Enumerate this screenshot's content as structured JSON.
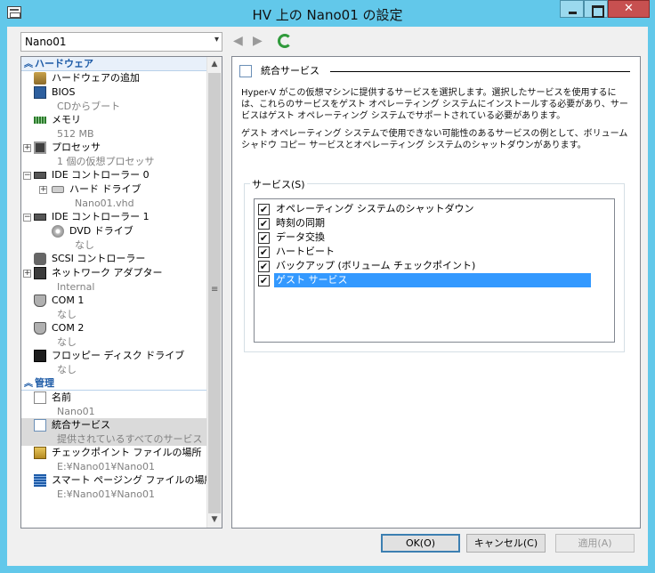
{
  "window": {
    "title": "HV 上の Nano01 の設定"
  },
  "vm_selector": {
    "value": "Nano01"
  },
  "tree": {
    "hardware_header": "ハードウェア",
    "management_header": "管理",
    "items": [
      {
        "label": "ハードウェアの追加",
        "sub": ""
      },
      {
        "label": "BIOS",
        "sub": "CDからブート"
      },
      {
        "label": "メモリ",
        "sub": "512 MB"
      },
      {
        "label": "プロセッサ",
        "sub": "1 個の仮想プロセッサ"
      },
      {
        "label": "IDE コントローラー 0",
        "sub": ""
      },
      {
        "label": "ハード ドライブ",
        "sub": "Nano01.vhd"
      },
      {
        "label": "IDE コントローラー 1",
        "sub": ""
      },
      {
        "label": "DVD ドライブ",
        "sub": "なし"
      },
      {
        "label": "SCSI コントローラー",
        "sub": ""
      },
      {
        "label": "ネットワーク アダプター",
        "sub": "Internal"
      },
      {
        "label": "COM 1",
        "sub": "なし"
      },
      {
        "label": "COM 2",
        "sub": "なし"
      },
      {
        "label": "フロッピー ディスク ドライブ",
        "sub": "なし"
      }
    ],
    "mgmt_items": [
      {
        "label": "名前",
        "sub": "Nano01"
      },
      {
        "label": "統合サービス",
        "sub": "提供されているすべてのサービス"
      },
      {
        "label": "チェックポイント ファイルの場所",
        "sub": "E:¥Nano01¥Nano01"
      },
      {
        "label": "スマート ページング ファイルの場所",
        "sub": "E:¥Nano01¥Nano01"
      }
    ]
  },
  "panel": {
    "title": "統合サービス",
    "desc1": "Hyper-V がこの仮想マシンに提供するサービスを選択します。選択したサービスを使用するには、これらのサービスをゲスト オペレーティング システムにインストールする必要があり、サービスはゲスト オペレーティング システムでサポートされている必要があります。",
    "desc2": "ゲスト オペレーティング システムで使用できない可能性のあるサービスの例として、ボリューム シャドウ コピー サービスとオペレーティング システムのシャットダウンがあります。",
    "group_label": "サービス(S)",
    "services": [
      {
        "label": "オペレーティング システムのシャットダウン",
        "checked": true
      },
      {
        "label": "時刻の同期",
        "checked": true
      },
      {
        "label": "データ交換",
        "checked": true
      },
      {
        "label": "ハートビート",
        "checked": true
      },
      {
        "label": "バックアップ (ボリューム チェックポイント)",
        "checked": true
      },
      {
        "label": "ゲスト サービス",
        "checked": true
      }
    ],
    "check_mark": "✔"
  },
  "buttons": {
    "ok": "OK(O)",
    "cancel": "キャンセル(C)",
    "apply": "適用(A)"
  },
  "glyphs": {
    "dropdown": "▾",
    "scroll_up": "▲",
    "scroll_down": "▼",
    "grip": "≡",
    "back": "◀",
    "forward": "▶",
    "collapse": "⌃",
    "expand": "+",
    "minus": "−"
  }
}
